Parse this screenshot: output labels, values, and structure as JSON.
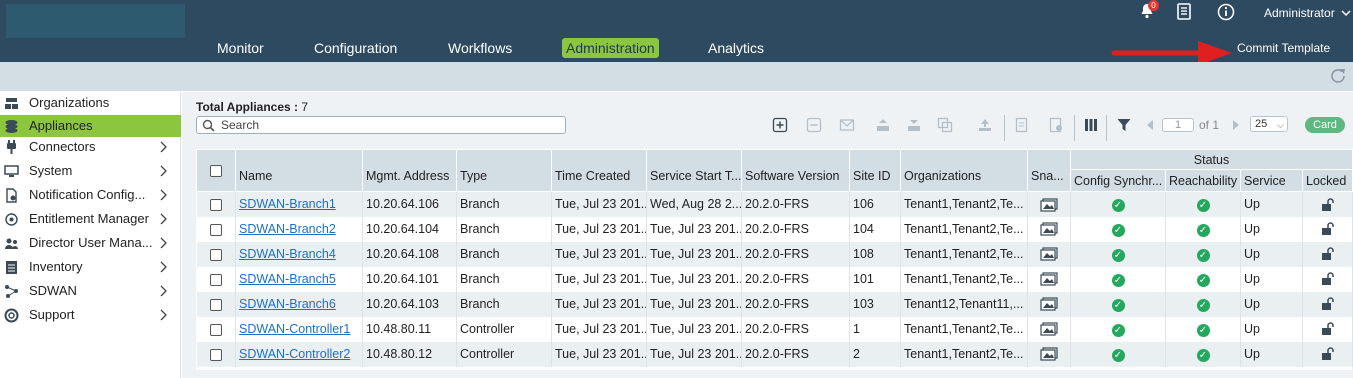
{
  "header": {
    "nav": [
      {
        "label": "Monitor"
      },
      {
        "label": "Configuration"
      },
      {
        "label": "Workflows"
      },
      {
        "label": "Administration",
        "active": true
      },
      {
        "label": "Analytics"
      }
    ],
    "notification_count": "0",
    "user": "Administrator",
    "commit_template": "Commit Template"
  },
  "sidebar": {
    "items": [
      {
        "label": "Organizations",
        "icon": "organizations-icon",
        "chevron": false
      },
      {
        "label": "Appliances",
        "icon": "appliances-icon",
        "chevron": false,
        "active": true
      },
      {
        "label": "Connectors",
        "icon": "connectors-icon",
        "chevron": true
      },
      {
        "label": "System",
        "icon": "system-icon",
        "chevron": true
      },
      {
        "label": "Notification Config...",
        "icon": "notification-icon",
        "chevron": true
      },
      {
        "label": "Entitlement Manager",
        "icon": "entitlement-icon",
        "chevron": true
      },
      {
        "label": "Director User Mana...",
        "icon": "users-icon",
        "chevron": true
      },
      {
        "label": "Inventory",
        "icon": "inventory-icon",
        "chevron": true
      },
      {
        "label": "SDWAN",
        "icon": "sdwan-icon",
        "chevron": true
      },
      {
        "label": "Support",
        "icon": "support-icon",
        "chevron": true
      }
    ]
  },
  "main": {
    "total_label": "Total Appliances :",
    "total_value": "7",
    "search_placeholder": "Search",
    "pagination": {
      "page": "1",
      "of_label": "of 1",
      "page_size": "25"
    },
    "card_label": "Card"
  },
  "table": {
    "status_group": "Status",
    "columns": [
      "Name",
      "Mgmt. Address",
      "Type",
      "Time Created",
      "Service Start T...",
      "Software Version",
      "Site ID",
      "Organizations",
      "Sna...",
      "Config Synchr...",
      "Reachability",
      "Service",
      "Locked"
    ],
    "rows": [
      {
        "name": "SDWAN-Branch1",
        "mgmt": "10.20.64.106",
        "type": "Branch",
        "created": "Tue, Jul 23 201...",
        "start": "Wed, Aug 28 2...",
        "version": "20.2.0-FRS",
        "site": "106",
        "orgs": "Tenant1,Tenant2,Te...",
        "service": "Up"
      },
      {
        "name": "SDWAN-Branch2",
        "mgmt": "10.20.64.104",
        "type": "Branch",
        "created": "Tue, Jul 23 201...",
        "start": "Tue, Jul 23 201...",
        "version": "20.2.0-FRS",
        "site": "104",
        "orgs": "Tenant1,Tenant2,Te...",
        "service": "Up"
      },
      {
        "name": "SDWAN-Branch4",
        "mgmt": "10.20.64.108",
        "type": "Branch",
        "created": "Tue, Jul 23 201...",
        "start": "Tue, Jul 23 201...",
        "version": "20.2.0-FRS",
        "site": "108",
        "orgs": "Tenant1,Tenant2,Te...",
        "service": "Up"
      },
      {
        "name": "SDWAN-Branch5",
        "mgmt": "10.20.64.101",
        "type": "Branch",
        "created": "Tue, Jul 23 201...",
        "start": "Tue, Jul 23 201...",
        "version": "20.2.0-FRS",
        "site": "101",
        "orgs": "Tenant1,Tenant2,Te...",
        "service": "Up"
      },
      {
        "name": "SDWAN-Branch6",
        "mgmt": "10.20.64.103",
        "type": "Branch",
        "created": "Tue, Jul 23 201...",
        "start": "Tue, Jul 23 201...",
        "version": "20.2.0-FRS",
        "site": "103",
        "orgs": "Tenant12,Tenant11,...",
        "service": "Up"
      },
      {
        "name": "SDWAN-Controller1",
        "mgmt": "10.48.80.11",
        "type": "Controller",
        "created": "Tue, Jul 23 201...",
        "start": "Tue, Jul 23 201...",
        "version": "20.2.0-FRS",
        "site": "1",
        "orgs": "Tenant1,Tenant2,Te...",
        "service": "Up"
      },
      {
        "name": "SDWAN-Controller2",
        "mgmt": "10.48.80.12",
        "type": "Controller",
        "created": "Tue, Jul 23 201...",
        "start": "Tue, Jul 23 201...",
        "version": "20.2.0-FRS",
        "site": "2",
        "orgs": "Tenant1,Tenant2,Te...",
        "service": "Up"
      }
    ]
  },
  "colors": {
    "accent": "#8cc63f",
    "header": "#2e4a61",
    "status_ok": "#23a85e",
    "link": "#1c70c4",
    "card": "#5fb87f"
  }
}
